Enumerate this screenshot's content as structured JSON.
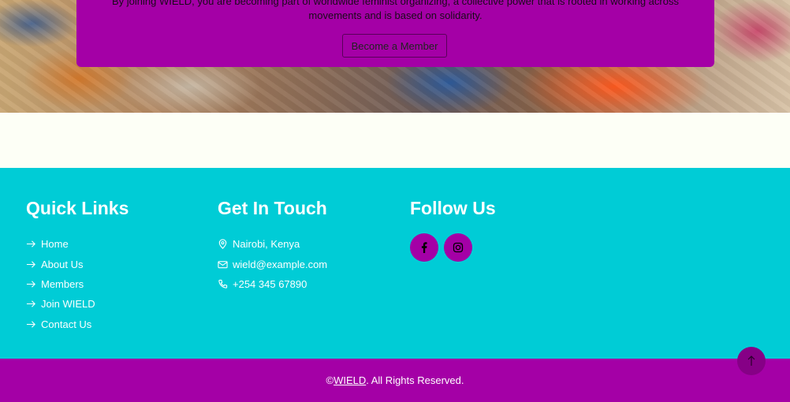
{
  "membership": {
    "text": "By joining WIELD, you are becoming part of worldwide feminist organizing, a collective power that is rooted in working across movements and is based on solidarity.",
    "button_label": "Become a Member"
  },
  "footer": {
    "quick_links": {
      "title": "Quick Links",
      "icon": "arrow-right-icon",
      "items": [
        {
          "label": "Home"
        },
        {
          "label": "About Us"
        },
        {
          "label": "Members"
        },
        {
          "label": "Join WIELD"
        },
        {
          "label": "Contact Us"
        }
      ]
    },
    "contact": {
      "title": "Get In Touch",
      "items": [
        {
          "icon": "map-pin-icon",
          "label": "Nairobi, Kenya"
        },
        {
          "icon": "envelope-icon",
          "label": "wield@example.com"
        },
        {
          "icon": "phone-icon",
          "label": "+254 345 67890"
        }
      ]
    },
    "social": {
      "title": "Follow Us",
      "items": [
        {
          "icon": "facebook-icon",
          "name": "Facebook"
        },
        {
          "icon": "instagram-icon",
          "name": "Instagram"
        }
      ]
    }
  },
  "copyright": {
    "prefix": "© ",
    "brand": "WIELD",
    "suffix": ". All Rights Reserved."
  },
  "back_to_top": {
    "icon": "arrow-up-icon"
  },
  "colors": {
    "brand_purple": "#a400a6",
    "footer_teal": "#00ccd6",
    "back_to_top": "#860086"
  }
}
